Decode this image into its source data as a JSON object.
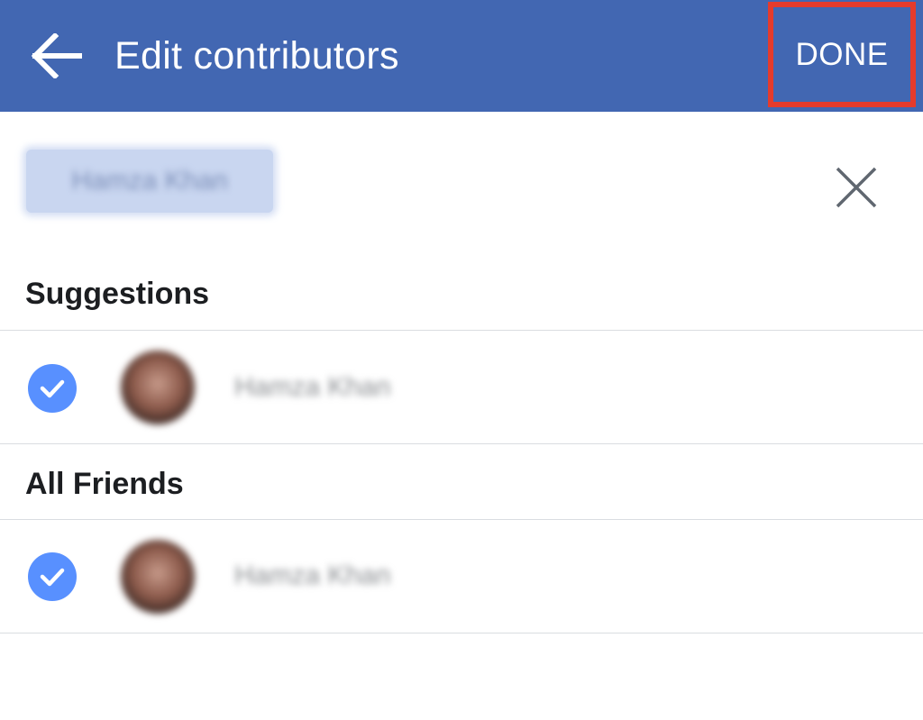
{
  "header": {
    "title": "Edit contributors",
    "done_label": "DONE",
    "accent_color": "#4267b2",
    "highlight_color": "#e53b2c"
  },
  "selected": {
    "token_label": "Hamza Khan"
  },
  "sections": {
    "suggestions": {
      "title": "Suggestions",
      "items": [
        {
          "name": "Hamza Khan",
          "checked": true
        }
      ]
    },
    "all_friends": {
      "title": "All Friends",
      "items": [
        {
          "name": "Hamza Khan",
          "checked": true
        }
      ]
    }
  },
  "icons": {
    "back": "arrow-left-icon",
    "clear": "close-icon",
    "check": "check-circle-icon"
  }
}
